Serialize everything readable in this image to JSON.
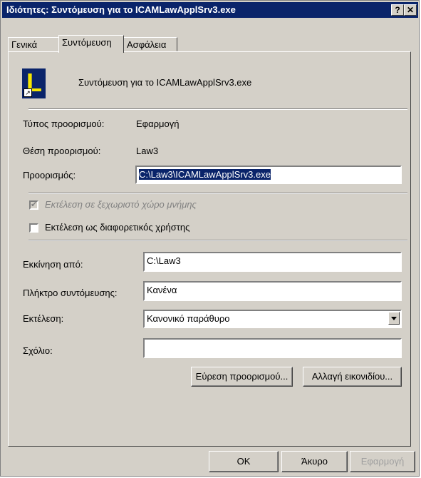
{
  "window": {
    "title": "Ιδιότητες: Συντόμευση για το ICAMLawApplSrv3.exe",
    "help_label": "?",
    "close_label": "✕"
  },
  "tabs": [
    "Γενικά",
    "Συντόμευση",
    "Ασφάλεια"
  ],
  "header": {
    "name": "Συντόμευση για το ICAMLawApplSrv3.exe",
    "icon_letter": "L"
  },
  "info": {
    "type_label": "Τύπος προορισμού:",
    "type_value": "Εφαρμογή",
    "location_label": "Θέση προορισμού:",
    "location_value": "Law3",
    "target_label": "Προορισμός:",
    "target_value": "C:\\Law3\\ICAMLawApplSrv3.exe"
  },
  "options": {
    "separate_memory_label": "Εκτέλεση σε ξεχωριστό χώρο μνήμης",
    "separate_memory_checked": true,
    "separate_memory_enabled": false,
    "run_as_label": "Εκτέλεση ως διαφορετικός χρήστης",
    "run_as_checked": false
  },
  "fields": {
    "start_in_label": "Εκκίνηση από:",
    "start_in_value": "C:\\Law3",
    "shortcut_key_label": "Πλήκτρο συντόμευσης:",
    "shortcut_key_value": "Κανένα",
    "run_label": "Εκτέλεση:",
    "run_value": "Κανονικό παράθυρο",
    "comment_label": "Σχόλιο:",
    "comment_value": ""
  },
  "buttons": {
    "find_target": "Εύρεση προορισμού...",
    "change_icon": "Αλλαγή εικονιδίου...",
    "ok": "OK",
    "cancel": "Άκυρο",
    "apply": "Εφαρμογή"
  },
  "colors": {
    "titlebar": "#0a246a",
    "face": "#d4d0c8",
    "icon_bg": "#0a246a",
    "icon_letter": "#f5e600"
  }
}
